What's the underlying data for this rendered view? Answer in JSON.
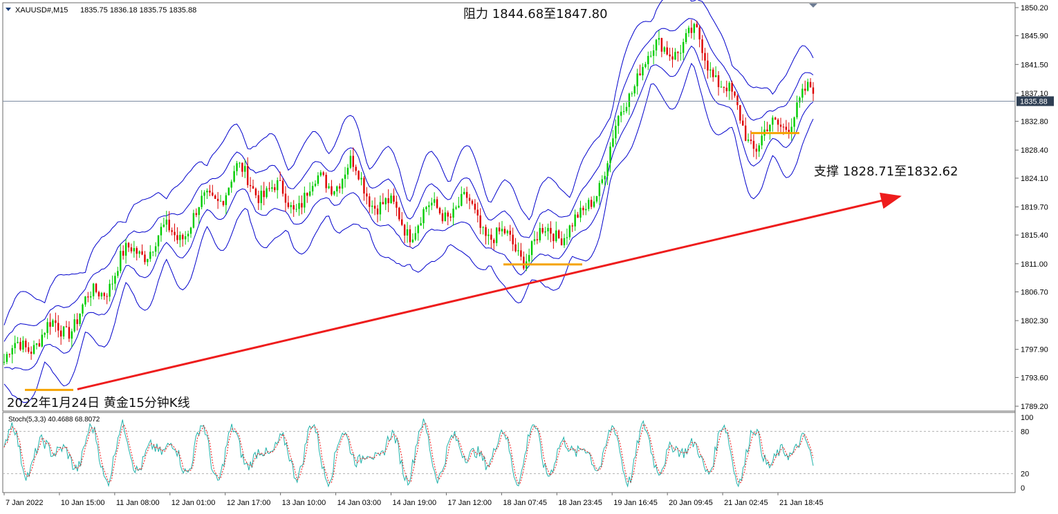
{
  "header": {
    "symbol": "XAUUSD#,M15",
    "ohlc": "1835.75 1836.18 1835.75 1835.88"
  },
  "stoch_label": "Stoch(5,3,3) 40.4688 68.8072",
  "annotations": {
    "resistance": "阻力 1844.68至1847.80",
    "support": "支撑 1828.71至1832.62",
    "caption": "2022年1月24日 黄金15分钟K线"
  },
  "current_price": "1835.88",
  "colors": {
    "bull": "#00cc00",
    "bear": "#dd0000",
    "bands": "#0000cc",
    "trendline": "#ee1c1c",
    "support_lines": "#f5a300",
    "stoch_main": "#20b2aa",
    "stoch_signal": "#ee1111",
    "price_tag_bg": "#2f3f54"
  },
  "chart_data": [
    {
      "type": "line",
      "title": "XAUUSD#,M15",
      "price_ticks": [
        "1850.20",
        "1845.90",
        "1841.50",
        "1837.10",
        "1832.80",
        "1828.40",
        "1824.10",
        "1819.70",
        "1815.40",
        "1811.00",
        "1806.70",
        "1802.30",
        "1797.90",
        "1793.60",
        "1789.20"
      ],
      "ylim": [
        1789.2,
        1850.2
      ],
      "time_labels": [
        "7 Jan 2022",
        "10 Jan 15:00",
        "11 Jan 08:00",
        "12 Jan 01:00",
        "12 Jan 17:00",
        "13 Jan 10:00",
        "14 Jan 03:00",
        "14 Jan 19:00",
        "17 Jan 12:00",
        "18 Jan 07:45",
        "18 Jan 23:45",
        "19 Jan 16:45",
        "20 Jan 09:45",
        "21 Jan 02:45",
        "21 Jan 18:45"
      ],
      "series": [
        {
          "name": "XAUUSD#,M15",
          "x": [
            "7 Jan 2022",
            "10 Jan 15:00",
            "11 Jan 08:00",
            "12 Jan 01:00",
            "12 Jan 17:00",
            "13 Jan 10:00",
            "14 Jan 03:00",
            "14 Jan 19:00",
            "17 Jan 12:00",
            "18 Jan 07:45",
            "18 Jan 23:45",
            "19 Jan 16:45",
            "20 Jan 09:45",
            "21 Jan 02:45",
            "21 Jan 18:45"
          ],
          "values": [
            1796.0,
            1800.5,
            1812.0,
            1814.5,
            1826.0,
            1819.0,
            1826.5,
            1816.0,
            1820.0,
            1813.0,
            1816.5,
            1843.0,
            1844.0,
            1830.5,
            1836.0
          ]
        }
      ],
      "support_levels": [
        1791.7,
        1810.9,
        1831.0
      ],
      "trendline": {
        "from": [
          "10 Jan 15:00",
          1791.8
        ],
        "to": [
          "21 Jan 18:45",
          1821.3
        ]
      },
      "grid": false
    },
    {
      "type": "line",
      "title": "Stoch(5,3,3) 40.4688 68.8072",
      "levels": [
        100,
        80,
        20,
        0
      ],
      "ylim": [
        0,
        100
      ],
      "series": [
        {
          "name": "main",
          "values": [
            40.4688
          ]
        },
        {
          "name": "signal",
          "values": [
            68.8072
          ]
        }
      ]
    }
  ]
}
